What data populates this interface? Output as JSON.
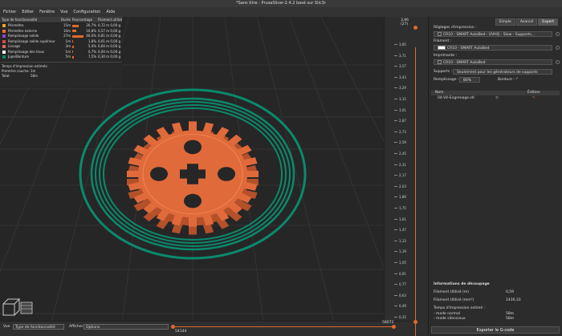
{
  "window": {
    "title": "*Sans titre - PrusaSlicer-2.4.2 basé sur Slic3r"
  },
  "menu": [
    "Fichier",
    "Editer",
    "Fenêtre",
    "Vue",
    "Configuration",
    "Aide"
  ],
  "legend": {
    "headers": [
      "Type de fonctionnalité",
      "Durée",
      "Pourcentage",
      "Filament utilisé"
    ],
    "rows": [
      {
        "label": "Périmètre",
        "time": "15m",
        "pct": "26,7%",
        "fil": "0,72 m   0,00 g",
        "color": "#f8a32b",
        "frac": 0.267
      },
      {
        "label": "Périmètre externe",
        "time": "10m",
        "pct": "16,8%",
        "fil": "0,57 m   0,00 g",
        "color": "#f26a27",
        "frac": 0.168
      },
      {
        "label": "Remplissage solide",
        "time": "27m",
        "pct": "46,0%",
        "fil": "0,81 m   0,00 g",
        "color": "#9442d1",
        "frac": 0.46
      },
      {
        "label": "Remplissage solide supérieur",
        "time": "1m",
        "pct": "1,8%",
        "fil": "0,01 m   0,00 g",
        "color": "#e04848",
        "frac": 0.018
      },
      {
        "label": "Lissage",
        "time": "3m",
        "pct": "5,4%",
        "fil": "0,00 m   0,00 g",
        "color": "#e06a6a",
        "frac": 0.054
      },
      {
        "label": "Remplissage des trous",
        "time": "1m",
        "pct": "0,7%",
        "fil": "0,00 m   0,00 g",
        "color": "#ffffff",
        "frac": 0.007
      },
      {
        "label": "Jupe/Bordure",
        "time": "5m",
        "pct": "7,5%",
        "fil": "0,30 m   0,00 g",
        "color": "#0a8a6c",
        "frac": 0.075
      }
    ],
    "estimate_title": "Temps d'impression estimés:",
    "first_layer_label": "Première couche:",
    "first_layer_value": "1m",
    "total_label": "Total:",
    "total_value": "58m"
  },
  "ruler": {
    "top": "3,96",
    "top_sub": "(27)",
    "bottom": "0,20",
    "bottom_sub": "(1)",
    "ticks": [
      "3,85",
      "3,71",
      "3,57",
      "3,43",
      "3,29",
      "3,15",
      "3,01",
      "2,87",
      "2,73",
      "2,59",
      "2,45",
      "2,31",
      "2,17",
      "2,03",
      "1,89",
      "1,75",
      "1,61",
      "1,47",
      "1,33",
      "1,19",
      "1,05",
      "0,91",
      "0,77",
      "0,63",
      "0,49",
      "0,35"
    ]
  },
  "panel": {
    "tabs": [
      "Simple",
      "Avancé",
      "Expert"
    ],
    "print_settings_label": "Réglages d'impression :",
    "print_settings_value": "CR10 - SMART AutoBed - UVHQ - Slow - Supports...",
    "filament_label": "Filament :",
    "filament_value": "CR10 - SMART AutoBed",
    "printer_label": "Imprimante :",
    "printer_value": "CR10 - SMART AutoBed",
    "supports_label": "Supports :",
    "supports_value": "Seulement pour les générateurs de supports",
    "infill_label": "Remplissage :",
    "infill_value": "80%",
    "brim_label": "Bordure :",
    "brim_check": "✓",
    "obj_name_header": "Nom",
    "obj_edit_header": "Édition",
    "obj_name": "04-V4-Engrenage.stl",
    "info_title": "Informations de découpage",
    "info": [
      {
        "k": "Filament Utilisé (m)",
        "v": "0,59"
      },
      {
        "k": "Filament Utilisé (mm³)",
        "v": "1430,33"
      }
    ],
    "time_title": "Temps d'impression estimé :",
    "time_rows": [
      {
        "k": "- mode normal",
        "v": "58m"
      },
      {
        "k": "- mode silencieux",
        "v": "58m"
      }
    ],
    "export": "Exporter le G-code"
  },
  "bottom": {
    "view_label": "Vue",
    "view_value": "Type de fonctionnalité",
    "show_label": "Afficher",
    "show_value": "Options",
    "moves_left": "54144",
    "moves_right": "58072"
  },
  "colors": {
    "accent": "#e06a2a",
    "gear": "#e06a3a",
    "skirt": "#0a8a6c"
  }
}
